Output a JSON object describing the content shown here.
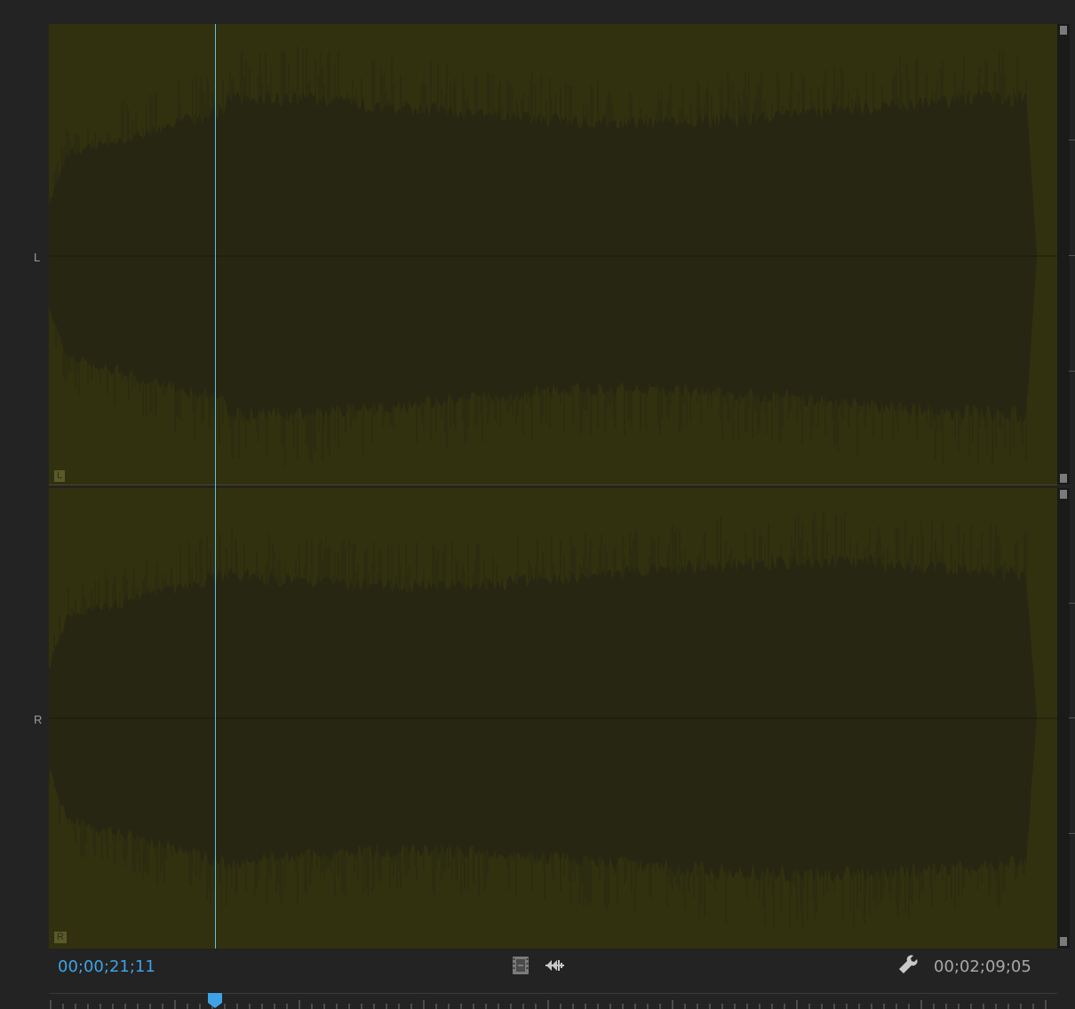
{
  "channels": [
    {
      "id": "L",
      "side_label": "L",
      "corner_label": "L"
    },
    {
      "id": "R",
      "side_label": "R",
      "corner_label": "R"
    }
  ],
  "timecode": {
    "current": "00;00;21;11",
    "duration": "00;02;09;05"
  },
  "toolbar": {
    "icons": [
      "insert-video-icon",
      "insert-audio-icon",
      "settings-wrench-icon"
    ]
  },
  "colors": {
    "waveform_background": "#31310f",
    "waveform_fill": "#262613",
    "panel_background": "#232323",
    "playhead": "#5ec1e4",
    "current_timecode": "#3ea3e6",
    "duration_timecode": "#a8a8a8"
  },
  "playhead_progress": 0.164
}
